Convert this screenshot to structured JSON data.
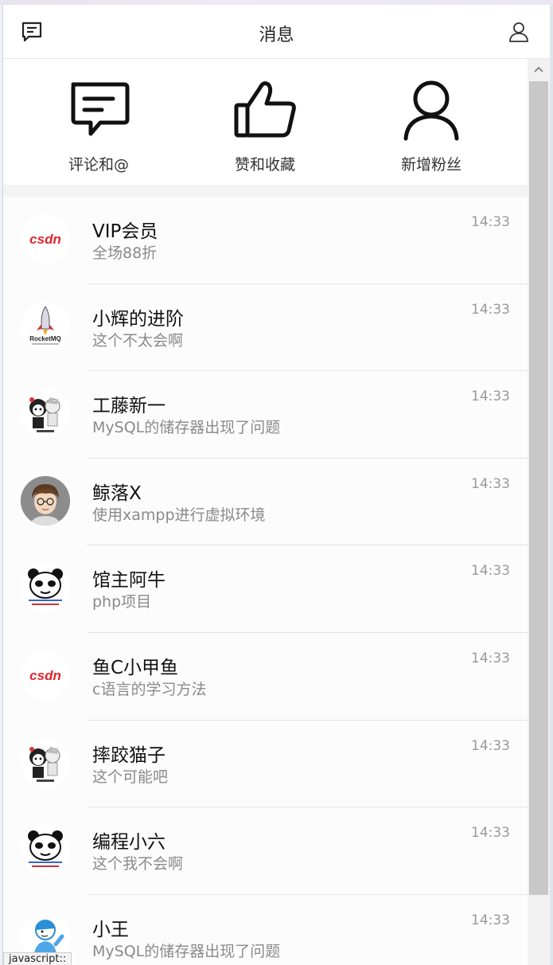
{
  "header": {
    "title": "消息",
    "left_icon": "message-list-icon",
    "right_icon": "user-profile-icon"
  },
  "quick_actions": [
    {
      "label": "评论和@",
      "icon": "comment-icon"
    },
    {
      "label": "赞和收藏",
      "icon": "thumbs-up-icon"
    },
    {
      "label": "新增粉丝",
      "icon": "new-follower-icon"
    }
  ],
  "conversations": [
    {
      "name": "VIP会员",
      "message": "全场88折",
      "time": "14:33",
      "avatar": "csdn",
      "logo_text": "CSDN"
    },
    {
      "name": "小辉的进阶",
      "message": "这个不太会啊",
      "time": "14:33",
      "avatar": "rocket",
      "logo_text": "RocketMQ"
    },
    {
      "name": "工藤新一",
      "message": "MySQL的储存器出现了问题",
      "time": "14:33",
      "avatar": "cartoon"
    },
    {
      "name": "鲸落X",
      "message": "使用xampp进行虚拟环境",
      "time": "14:33",
      "avatar": "photo"
    },
    {
      "name": "馆主阿牛",
      "message": "php项目",
      "time": "14:33",
      "avatar": "panda"
    },
    {
      "name": "鱼C小甲鱼",
      "message": "c语言的学习方法",
      "time": "14:33",
      "avatar": "csdn",
      "logo_text": "CSDN"
    },
    {
      "name": "摔跤猫子",
      "message": "这个可能吧",
      "time": "14:33",
      "avatar": "cartoon"
    },
    {
      "name": "编程小六",
      "message": "这个我不会啊",
      "time": "14:33",
      "avatar": "panda"
    },
    {
      "name": "小王",
      "message": "MySQL的储存器出现了问题",
      "time": "14:33",
      "avatar": "boy"
    }
  ],
  "status_bar": {
    "text": "javascript::"
  },
  "colors": {
    "csdn_red": "#e3242b",
    "time_gray": "#999999",
    "divider": "#e4e4e4"
  }
}
